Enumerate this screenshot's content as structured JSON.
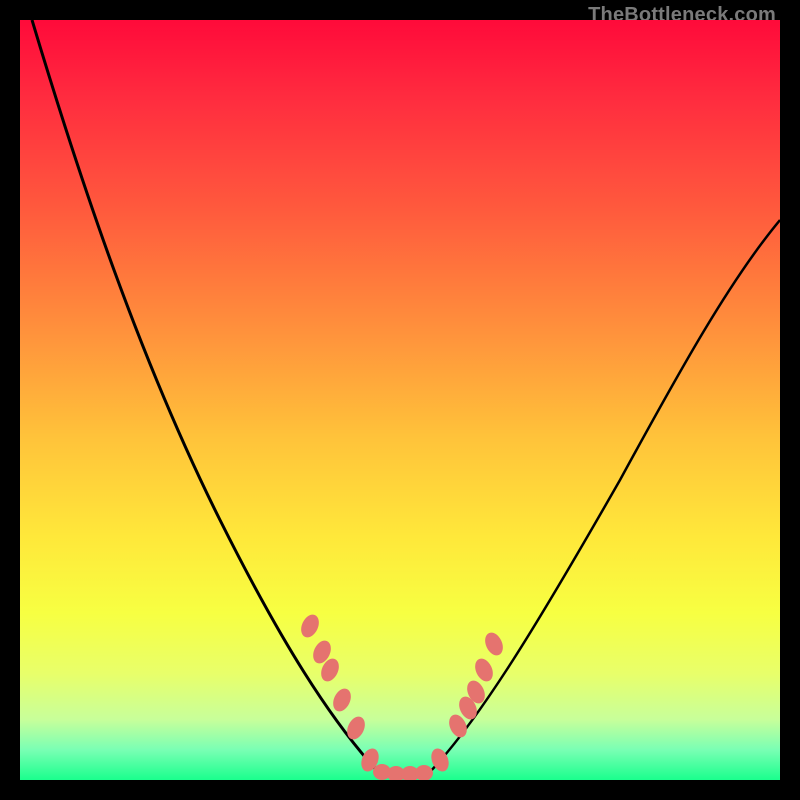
{
  "watermark": {
    "text": "TheBottleneck.com"
  },
  "chart_data": {
    "type": "line",
    "title": "",
    "xlabel": "",
    "ylabel": "",
    "xlim": [
      0,
      100
    ],
    "ylim": [
      0,
      100
    ],
    "series": [
      {
        "name": "main-curve",
        "x": [
          0,
          5,
          10,
          15,
          20,
          25,
          30,
          35,
          40,
          45,
          47,
          50,
          53,
          55,
          60,
          65,
          70,
          75,
          80,
          85,
          90,
          95,
          100
        ],
        "y": [
          100,
          90,
          80,
          70,
          60,
          50,
          40,
          30,
          20,
          10,
          3,
          0,
          0,
          3,
          8,
          15,
          22,
          30,
          38,
          46,
          54,
          62,
          70
        ]
      }
    ],
    "markers": {
      "name": "salmon-dots",
      "color": "#e5736f",
      "x": [
        38,
        40,
        41,
        43,
        45,
        47,
        48,
        49,
        50,
        51,
        52,
        53,
        54,
        56,
        57,
        58,
        59,
        60
      ],
      "y": [
        23,
        19,
        18,
        13,
        10,
        3,
        2,
        1,
        0,
        0,
        0,
        0,
        1,
        5,
        8,
        10,
        14,
        17
      ]
    },
    "background_gradient": {
      "stops": [
        {
          "pct": 0,
          "color": "#ff0a3a"
        },
        {
          "pct": 25,
          "color": "#ff5a3d"
        },
        {
          "pct": 55,
          "color": "#ffc33a"
        },
        {
          "pct": 78,
          "color": "#f7ff42"
        },
        {
          "pct": 100,
          "color": "#1aff8d"
        }
      ]
    }
  }
}
